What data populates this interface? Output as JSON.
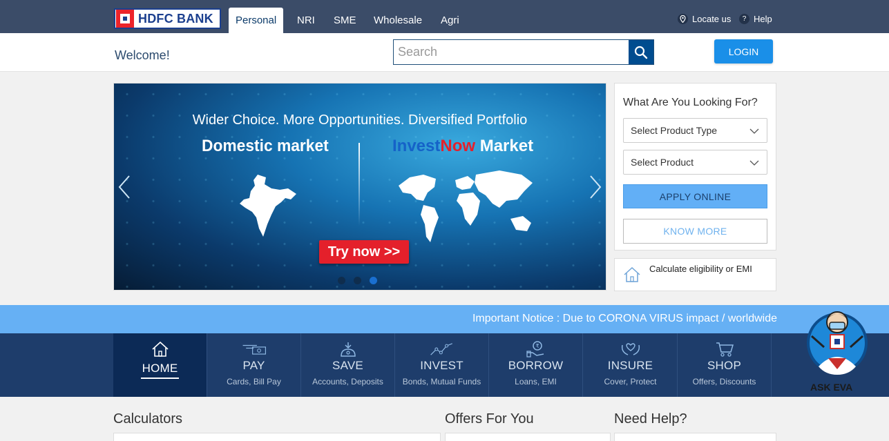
{
  "brand": {
    "name": "HDFC BANK"
  },
  "top_tabs": [
    {
      "label": "Personal",
      "active": true
    },
    {
      "label": "NRI",
      "active": false
    },
    {
      "label": "SME",
      "active": false
    },
    {
      "label": "Wholesale",
      "active": false
    },
    {
      "label": "Agri",
      "active": false
    }
  ],
  "top_links": {
    "locate": {
      "label": "Locate us",
      "icon": "location-pin-icon"
    },
    "help": {
      "label": "Help",
      "icon": "question-icon"
    }
  },
  "header": {
    "welcome": "Welcome!",
    "search_placeholder": "Search",
    "login_label": "LOGIN"
  },
  "banner": {
    "headline": "Wider Choice. More Opportunities. Diversified Portfolio",
    "left_label": "Domestic market",
    "right_label_parts": [
      "Invest",
      "Now",
      " Market"
    ],
    "cta": "Try now >>",
    "slides": 3,
    "active_slide": 3
  },
  "lookup": {
    "title": "What Are You Looking For?",
    "product_type_placeholder": "Select Product Type",
    "product_placeholder": "Select Product",
    "apply_label": "APPLY ONLINE",
    "know_label": "KNOW MORE"
  },
  "calc_link": {
    "label": "Calculate eligibility or EMI"
  },
  "notice": {
    "text": "Important Notice : Due to CORONA VIRUS impact / worldwide"
  },
  "nav": [
    {
      "title": "HOME",
      "sub": "",
      "icon": "home-icon",
      "active": true
    },
    {
      "title": "PAY",
      "sub": "Cards, Bill Pay",
      "icon": "card-icon",
      "active": false
    },
    {
      "title": "SAVE",
      "sub": "Accounts, Deposits",
      "icon": "savings-icon",
      "active": false
    },
    {
      "title": "INVEST",
      "sub": "Bonds, Mutual Funds",
      "icon": "growth-chart-icon",
      "active": false
    },
    {
      "title": "BORROW",
      "sub": "Loans, EMI",
      "icon": "loan-hand-icon",
      "active": false
    },
    {
      "title": "INSURE",
      "sub": "Cover, Protect",
      "icon": "protect-hands-icon",
      "active": false
    },
    {
      "title": "SHOP",
      "sub": "Offers, Discounts",
      "icon": "cart-icon",
      "active": false
    }
  ],
  "assistant": {
    "label": "ASK EVA"
  },
  "sections": {
    "calculators": "Calculators",
    "offers": "Offers For You",
    "help": "Need Help?"
  },
  "colors": {
    "topbar": "#3b4c68",
    "primary_blue": "#004c8f",
    "login": "#1a8fe8",
    "notice": "#66b0f4",
    "nav": "#1e3d6b",
    "brand_red": "#ed232a"
  }
}
